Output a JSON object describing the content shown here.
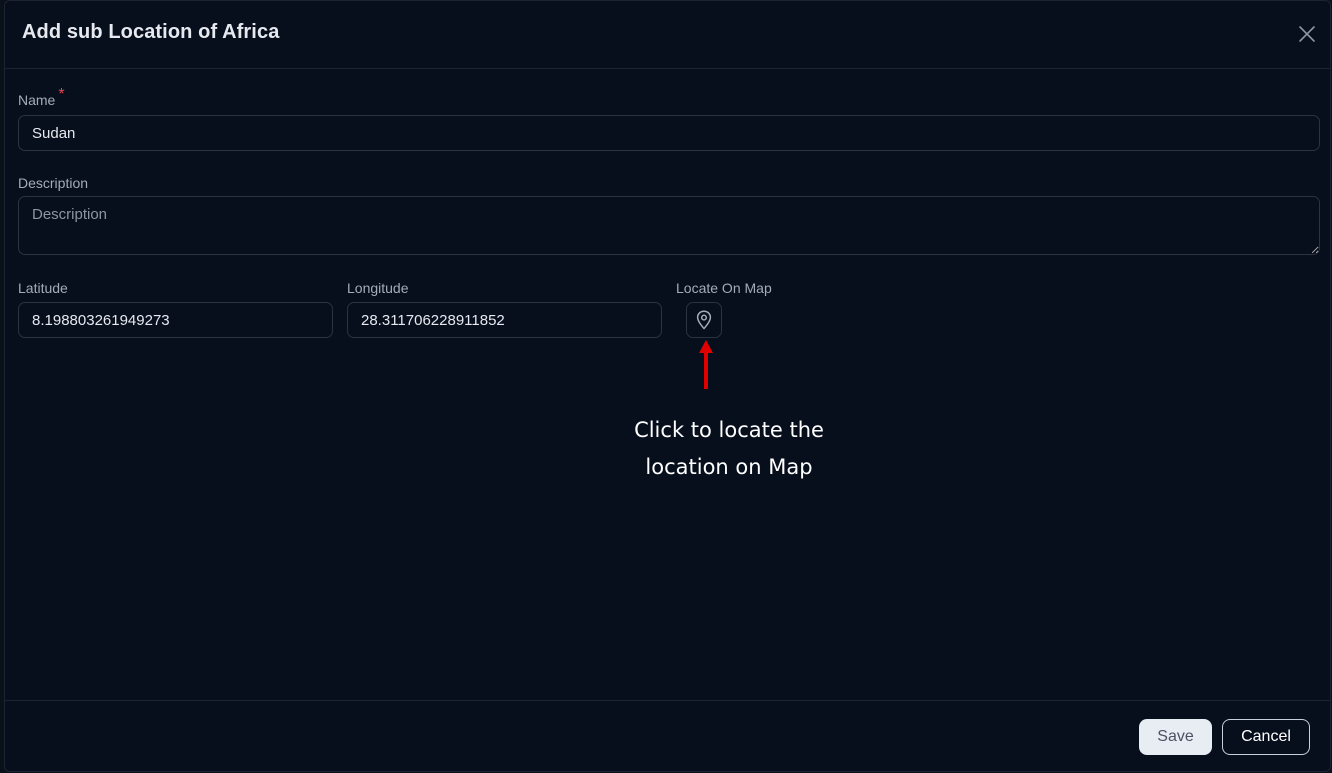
{
  "dialog": {
    "title": "Add sub Location of Africa"
  },
  "form": {
    "name": {
      "label": "Name",
      "required_marker": "*",
      "value": "Sudan"
    },
    "description": {
      "label": "Description",
      "placeholder": "Description",
      "value": ""
    },
    "latitude": {
      "label": "Latitude",
      "value": "8.198803261949273"
    },
    "longitude": {
      "label": "Longitude",
      "value": "28.311706228911852"
    },
    "locate": {
      "label": "Locate On Map",
      "icon": "map-pin-icon"
    }
  },
  "annotation": {
    "line1": "Click to locate the",
    "line2": "location on Map",
    "color": "#e00000"
  },
  "footer": {
    "save_label": "Save",
    "cancel_label": "Cancel"
  },
  "colors": {
    "background": "#070e1c",
    "border": "#2a3342",
    "required": "#e5484d",
    "save_bg": "#e8ecf3"
  }
}
